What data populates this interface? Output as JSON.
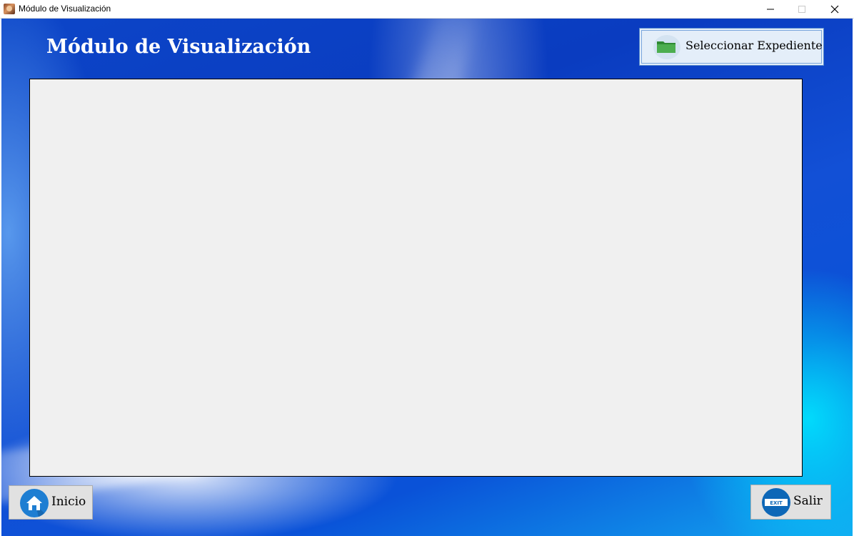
{
  "window": {
    "title": "Módulo de Visualización",
    "controls": {
      "minimize": "—",
      "maximize": "☐",
      "close": "✕"
    }
  },
  "header": {
    "title": "Módulo de Visualización"
  },
  "toolbar": {
    "select_file_label": "Seleccionar Expediente",
    "select_file_icon": "folder-icon"
  },
  "viewer": {
    "content": ""
  },
  "footer": {
    "home_label": "Inicio",
    "home_icon": "home-icon",
    "exit_label": "Salir",
    "exit_icon": "exit-sign-icon",
    "exit_sign_text": "EXIT"
  },
  "colors": {
    "background_primary": "#0c45c8",
    "background_highlight": "#12a6f0",
    "viewer_background": "#f0f0f0",
    "folder_green": "#3a9a3e",
    "home_blue": "#1e7ed2",
    "exit_blue": "#0d67b7"
  }
}
